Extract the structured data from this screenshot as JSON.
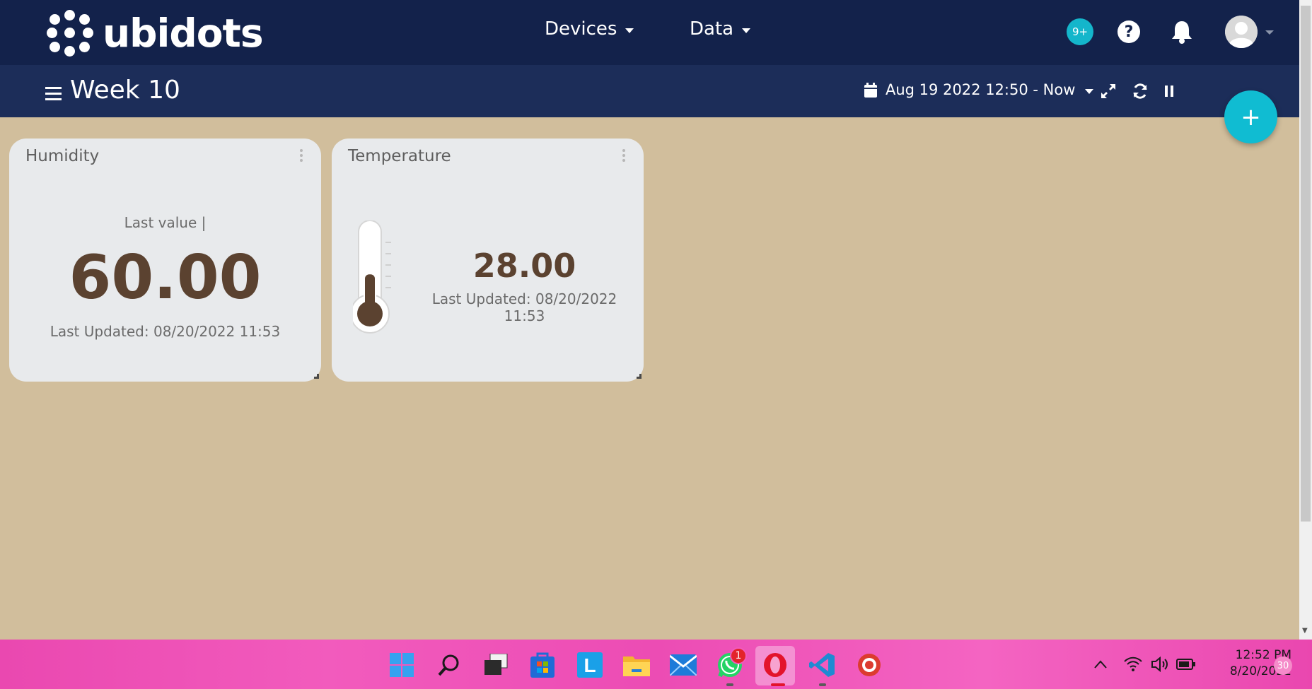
{
  "header": {
    "brand": "ubidots",
    "menus": [
      {
        "label": "Devices"
      },
      {
        "label": "Data"
      }
    ],
    "notifications_badge": "9+"
  },
  "dashboard": {
    "title": "Week 10",
    "date_range": "Aug 19 2022 12:50 - Now",
    "add_label": "+"
  },
  "widgets": {
    "humidity": {
      "title": "Humidity",
      "subtitle": "Last value |",
      "value": "60.00",
      "updated": "Last Updated: 08/20/2022 11:53"
    },
    "temperature": {
      "title": "Temperature",
      "value": "28.00",
      "updated": "Last Updated: 08/20/2022 11:53",
      "thermometer_fill": 0.45
    }
  },
  "taskbar": {
    "apps": [
      "windows-start",
      "search",
      "task-view",
      "microsoft-store",
      "l-app",
      "file-explorer",
      "mail",
      "whatsapp",
      "opera",
      "visual-studio-code",
      "chrome-app"
    ],
    "whatsapp_badge": "1",
    "time": "12:52 PM",
    "date": "8/20/2022",
    "notification_count": "30"
  },
  "colors": {
    "topbar": "#13224b",
    "subbar": "#1c2d59",
    "background": "#d1be9c",
    "accent": "#10bcd2",
    "value_text": "#5b4230"
  }
}
